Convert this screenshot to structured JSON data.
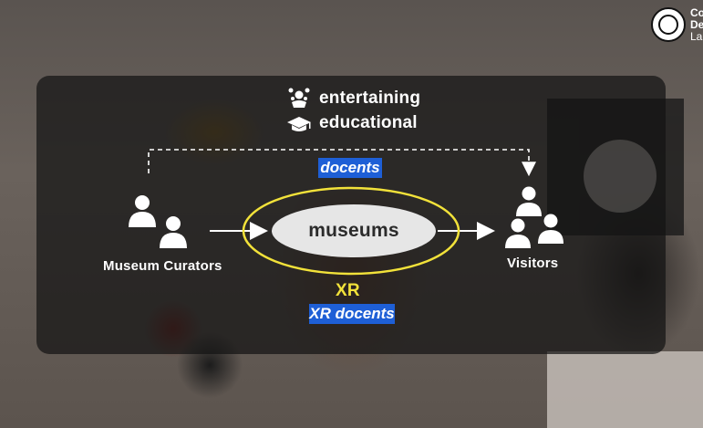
{
  "logo": {
    "lines": [
      "Co",
      "De",
      "La"
    ]
  },
  "attributes": [
    {
      "label": "entertaining",
      "icon": "people-celebrating-icon"
    },
    {
      "label": "educational",
      "icon": "graduation-cap-icon"
    }
  ],
  "tags": {
    "docents": "docents",
    "xr_docents": "XR docents"
  },
  "nodes": {
    "curators": "Museum Curators",
    "museums": "museums",
    "visitors": "Visitors",
    "xr": "XR"
  },
  "colors": {
    "tag_blue": "#1e5fd6",
    "xr_yellow": "#f2e23a",
    "ellipse_fill": "#e6e6e6",
    "ellipse_text": "#2b2b2b"
  }
}
